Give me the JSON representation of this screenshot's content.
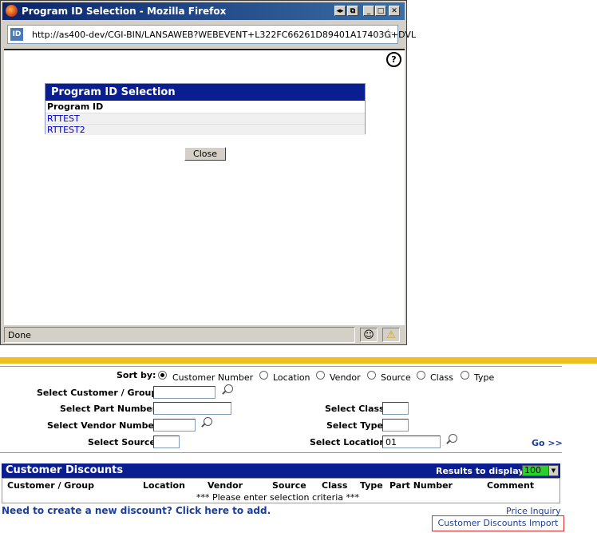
{
  "popup": {
    "title": "Program ID Selection - Mozilla Firefox",
    "url": "http://as400-dev/CGI-BIN/LANSAWEB?WEBEVENT+L322FC66261D89401A17403G+DVL",
    "url_icon": "ID",
    "help": "?",
    "panel_title": "Program ID Selection",
    "column": "Program ID",
    "rows": [
      "RTTEST",
      "RTTEST2"
    ],
    "close_label": "Close",
    "status": "Done",
    "win_buttons": [
      "◂▸",
      "⧉",
      "_",
      "□",
      "✕"
    ]
  },
  "search": {
    "sort_by_label": "Sort by:",
    "sort_options": [
      "Customer Number",
      "Location",
      "Vendor",
      "Source",
      "Class",
      "Type"
    ],
    "selected_sort": "Customer Number",
    "customer_label": "Select Customer / Group:",
    "part_label": "Select Part Number:",
    "vendor_label": "Select Vendor Number:",
    "source_label": "Select Source:",
    "class_label": "Select Class:",
    "type_label": "Select Type:",
    "location_label": "Select Location:",
    "location_value": "01",
    "go_label": "Go >>"
  },
  "discounts": {
    "title": "Customer Discounts",
    "results_label": "Results to display:",
    "results_value": "100",
    "columns": [
      "Customer / Group",
      "Location",
      "Vendor",
      "Source",
      "Class",
      "Type",
      "Part Number",
      "Comment"
    ],
    "message": "*** Please enter selection criteria ***",
    "add_link": "Need to create a new discount? Click here to add.",
    "price_inquiry": "Price Inquiry",
    "import_label": "Customer Discounts Import"
  }
}
